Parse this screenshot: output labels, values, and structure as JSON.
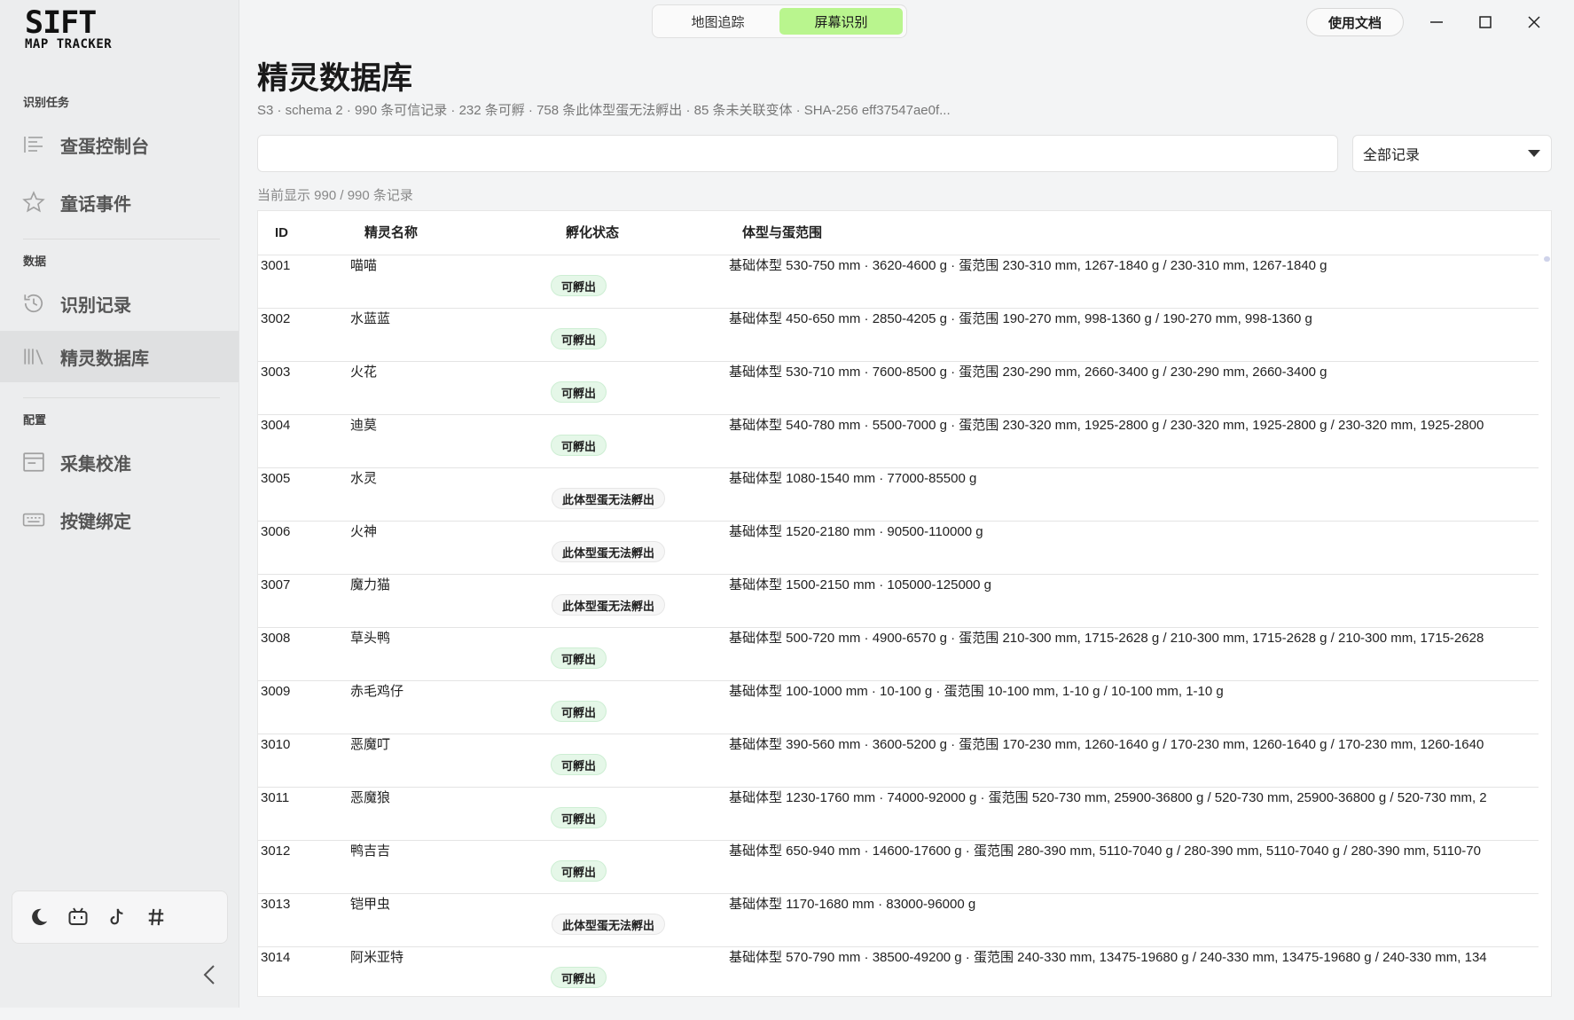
{
  "app": {
    "logo_line1": "SIFT",
    "logo_line2": "MAP TRACKER"
  },
  "sidebar": {
    "sections": [
      {
        "label": "识别任务",
        "items": [
          {
            "label": "查蛋控制台",
            "icon": "list-icon"
          },
          {
            "label": "童话事件",
            "icon": "star-icon"
          }
        ]
      },
      {
        "label": "数据",
        "items": [
          {
            "label": "识别记录",
            "icon": "history-icon"
          },
          {
            "label": "精灵数据库",
            "icon": "library-icon",
            "active": true
          }
        ]
      },
      {
        "label": "配置",
        "items": [
          {
            "label": "采集校准",
            "icon": "calibrate-icon"
          },
          {
            "label": "按键绑定",
            "icon": "keyboard-icon"
          }
        ]
      }
    ],
    "social_icons": [
      "moon-icon",
      "bilibili-icon",
      "tiktok-icon",
      "hash-icon"
    ]
  },
  "topbar": {
    "mode_tabs": [
      {
        "label": "地图追踪",
        "active": false
      },
      {
        "label": "屏幕识别",
        "active": true
      }
    ],
    "docs_label": "使用文档"
  },
  "main": {
    "title": "精灵数据库",
    "subtitle": "S3 · schema 2 · 990 条可信记录 · 232 条可孵 · 758 条此体型蛋无法孵出 · 85 条未关联变体 · SHA-256 eff37547ae0f...",
    "search_value": "",
    "search_placeholder": "",
    "filter_value": "全部记录",
    "count_text": "当前显示 990 / 990 条记录"
  },
  "table": {
    "headers": [
      "ID",
      "精灵名称",
      "孵化状态",
      "体型与蛋范围"
    ],
    "rows": [
      {
        "id": "3001",
        "name": "喵喵",
        "status": "可孵出",
        "ok": true,
        "body": "基础体型 530-750 mm · 3620-4600 g · 蛋范围 230-310 mm, 1267-1840 g / 230-310 mm, 1267-1840 g"
      },
      {
        "id": "3002",
        "name": "水蓝蓝",
        "status": "可孵出",
        "ok": true,
        "body": "基础体型 450-650 mm · 2850-4205 g · 蛋范围 190-270 mm, 998-1360 g / 190-270 mm, 998-1360 g"
      },
      {
        "id": "3003",
        "name": "火花",
        "status": "可孵出",
        "ok": true,
        "body": "基础体型 530-710 mm · 7600-8500 g · 蛋范围 230-290 mm, 2660-3400 g / 230-290 mm, 2660-3400 g"
      },
      {
        "id": "3004",
        "name": "迪莫",
        "status": "可孵出",
        "ok": true,
        "body": "基础体型 540-780 mm · 5500-7000 g · 蛋范围 230-320 mm, 1925-2800 g / 230-320 mm, 1925-2800 g / 230-320 mm, 1925-2800"
      },
      {
        "id": "3005",
        "name": "水灵",
        "status": "此体型蛋无法孵出",
        "ok": false,
        "body": "基础体型 1080-1540 mm · 77000-85500 g"
      },
      {
        "id": "3006",
        "name": "火神",
        "status": "此体型蛋无法孵出",
        "ok": false,
        "body": "基础体型 1520-2180 mm · 90500-110000 g"
      },
      {
        "id": "3007",
        "name": "魔力猫",
        "status": "此体型蛋无法孵出",
        "ok": false,
        "body": "基础体型 1500-2150 mm · 105000-125000 g"
      },
      {
        "id": "3008",
        "name": "草头鸭",
        "status": "可孵出",
        "ok": true,
        "body": "基础体型 500-720 mm · 4900-6570 g · 蛋范围 210-300 mm, 1715-2628 g / 210-300 mm, 1715-2628 g / 210-300 mm, 1715-2628"
      },
      {
        "id": "3009",
        "name": "赤毛鸡仔",
        "status": "可孵出",
        "ok": true,
        "body": "基础体型 100-1000 mm · 10-100 g · 蛋范围 10-100 mm, 1-10 g / 10-100 mm, 1-10 g"
      },
      {
        "id": "3010",
        "name": "恶魔叮",
        "status": "可孵出",
        "ok": true,
        "body": "基础体型 390-560 mm · 3600-5200 g · 蛋范围 170-230 mm, 1260-1640 g / 170-230 mm, 1260-1640 g / 170-230 mm, 1260-1640"
      },
      {
        "id": "3011",
        "name": "恶魔狼",
        "status": "可孵出",
        "ok": true,
        "body": "基础体型 1230-1760 mm · 74000-92000 g · 蛋范围 520-730 mm, 25900-36800 g / 520-730 mm, 25900-36800 g / 520-730 mm, 2"
      },
      {
        "id": "3012",
        "name": "鸭吉吉",
        "status": "可孵出",
        "ok": true,
        "body": "基础体型 650-940 mm · 14600-17600 g · 蛋范围 280-390 mm, 5110-7040 g / 280-390 mm, 5110-7040 g / 280-390 mm, 5110-70"
      },
      {
        "id": "3013",
        "name": "铠甲虫",
        "status": "此体型蛋无法孵出",
        "ok": false,
        "body": "基础体型 1170-1680 mm · 83000-96000 g"
      },
      {
        "id": "3014",
        "name": "阿米亚特",
        "status": "可孵出",
        "ok": true,
        "body": "基础体型 570-790 mm · 38500-49200 g · 蛋范围 240-330 mm, 13475-19680 g / 240-330 mm, 13475-19680 g / 240-330 mm, 134"
      }
    ]
  },
  "colors": {
    "accent": "#b9f58e",
    "badge_ok_bg": "#e5f7e8",
    "badge_no_bg": "#f6f6f6",
    "sidebar_bg": "#ecedee",
    "page_bg": "#f3f4f5"
  }
}
